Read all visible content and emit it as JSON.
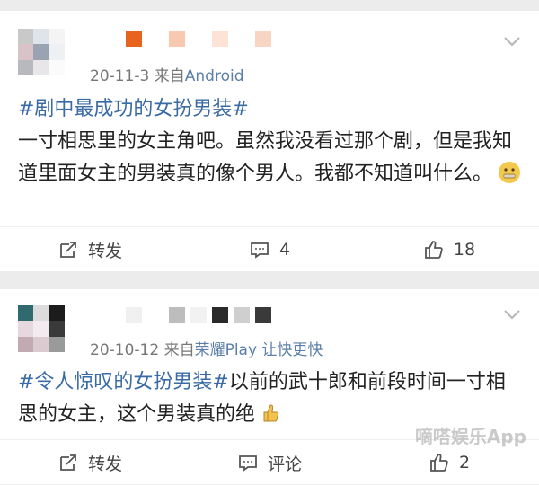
{
  "posts": [
    {
      "date": "20-11-3",
      "source_prefix": "来自",
      "source": "Android",
      "topic": "#剧中最成功的女扮男装#",
      "text": "一寸相思里的女主角吧。虽然我没看过那个剧，但是我知道里面女主的男装真的像个男人。我都不知道叫什么。",
      "emoji": "zipper-mouth-face",
      "actions": {
        "repost": "转发",
        "comment": "4",
        "like": "18"
      }
    },
    {
      "date": "20-10-12",
      "source_prefix": "来自",
      "source": "荣耀Play 让快更快",
      "topic": "#令人惊叹的女扮男装#",
      "text": "以前的武十郎和前段时间一寸相思的女主，这个男装真的绝",
      "emoji": "thumbs-up",
      "actions": {
        "repost": "转发",
        "comment": "评论",
        "like": "2"
      }
    }
  ],
  "watermark": "嘀嗒娱乐App",
  "colors": {
    "topic": "#3a6ba5",
    "source": "#5b7fa8",
    "meta": "#777777"
  }
}
